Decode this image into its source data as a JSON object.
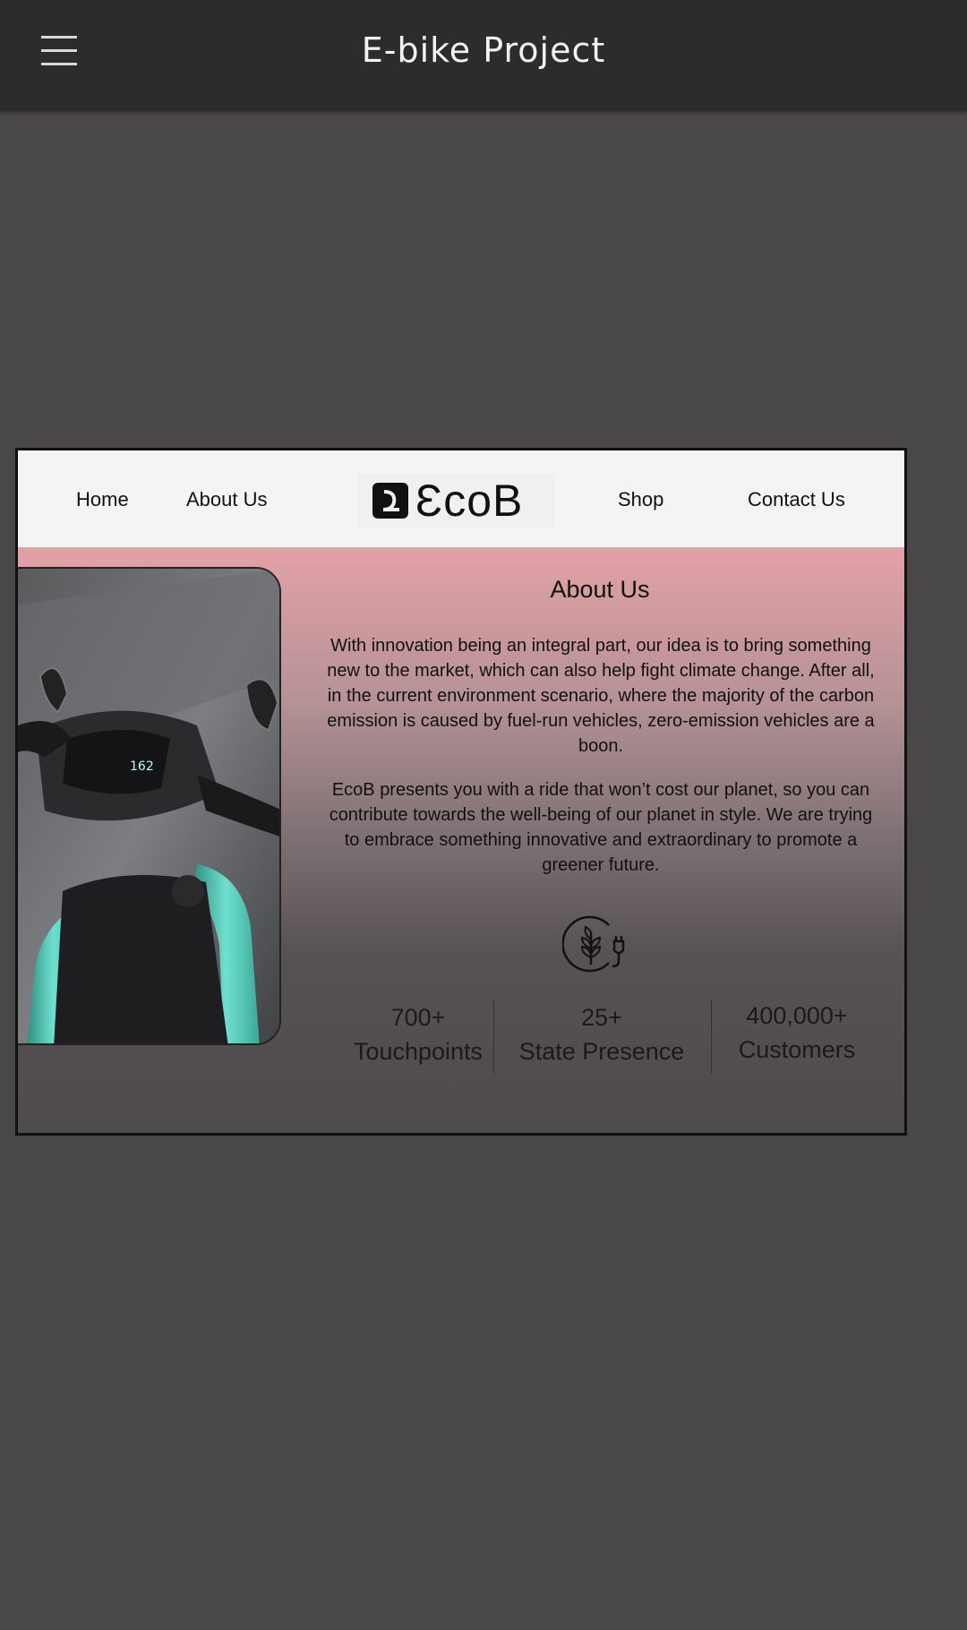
{
  "appbar": {
    "title": "E-bike Project",
    "menu_icon": "hamburger-menu-icon"
  },
  "site": {
    "nav": {
      "home": "Home",
      "about": "About Us",
      "shop": "Shop",
      "contact": "Contact Us"
    },
    "logo_text": "ƐcoB",
    "about": {
      "title": "About Us",
      "paragraph1": "With innovation being an integral part, our idea is to bring something new to the market, which can also help fight climate change.  After all, in the current environment scenario, where the majority of the carbon emission is caused by fuel-run vehicles, zero-emission vehicles are a boon.",
      "paragraph2": "EcoB presents you with a ride that won’t cost our planet, so you can contribute towards the well-being of our planet in style. We are trying to embrace something innovative and extraordinary to promote a greener future.",
      "icon": "eco-plant-plug-icon"
    },
    "stats": [
      {
        "value": "700+",
        "label": "Touchpoints"
      },
      {
        "value": "25+",
        "label": "State Presence"
      },
      {
        "value": "400,000+",
        "label": "Customers"
      }
    ],
    "dashboard_reading": "162"
  },
  "colors": {
    "appbar_bg": "#2d2c2d",
    "page_bg": "#4a4748",
    "hero_pink": "#f7aeb3",
    "accent_teal": "#5fd3c0"
  }
}
